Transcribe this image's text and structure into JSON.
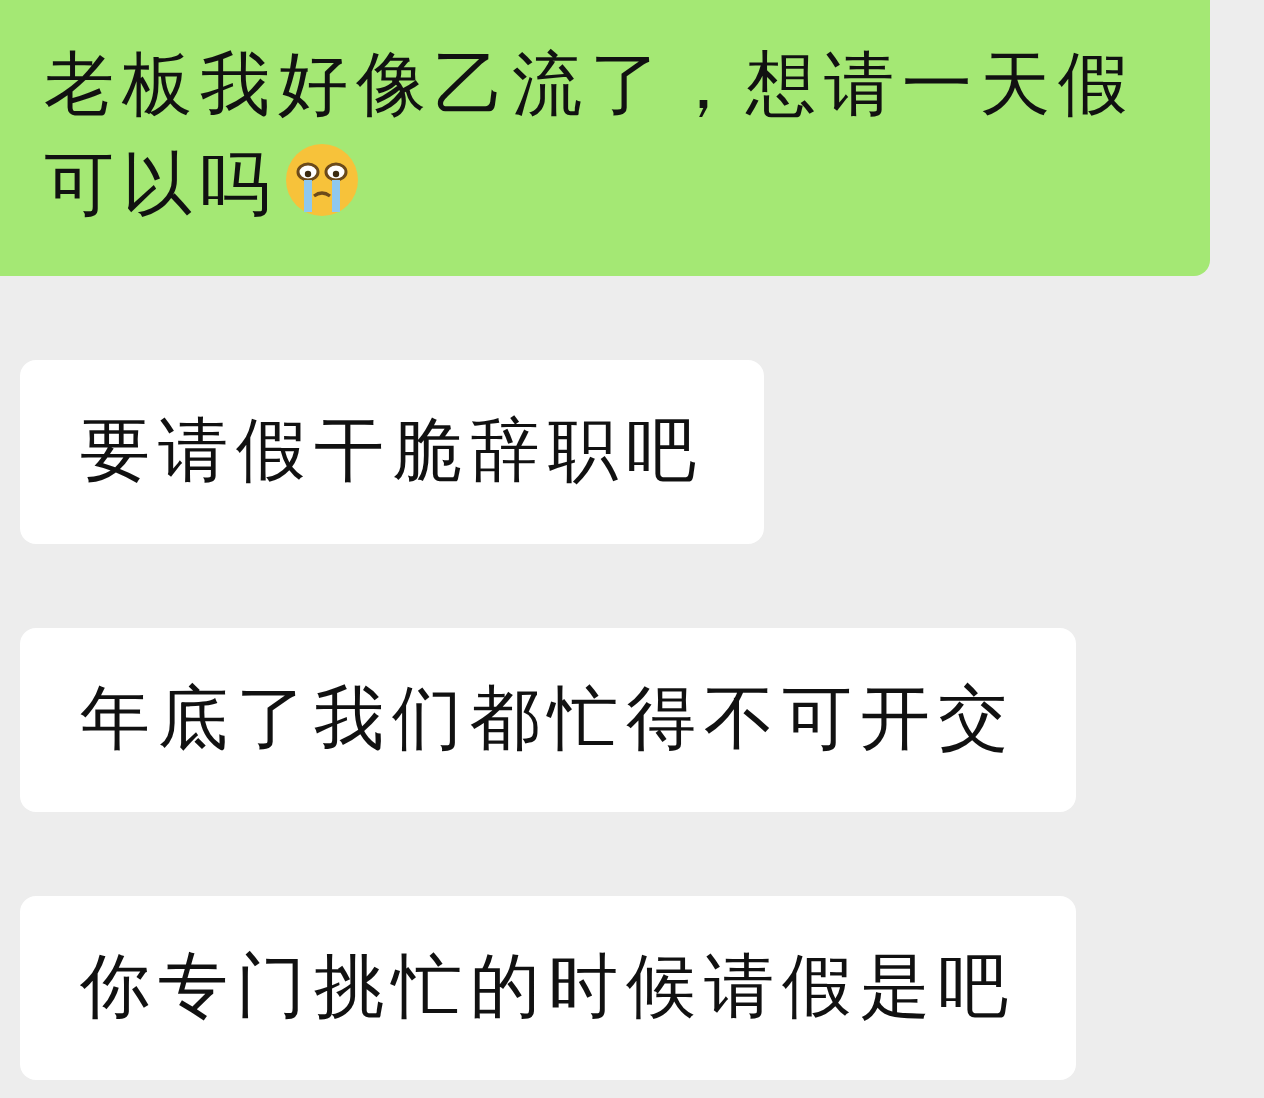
{
  "messages": [
    {
      "kind": "outgoing",
      "text": "老板我好像乙流了，想请一天假可以吗",
      "emoji": true
    },
    {
      "kind": "incoming",
      "text": "要请假干脆辞职吧",
      "emoji": false
    },
    {
      "kind": "incoming",
      "text": "年底了我们都忙得不可开交",
      "emoji": false
    },
    {
      "kind": "incoming",
      "text": "你专门挑忙的时候请假是吧",
      "emoji": false
    }
  ]
}
